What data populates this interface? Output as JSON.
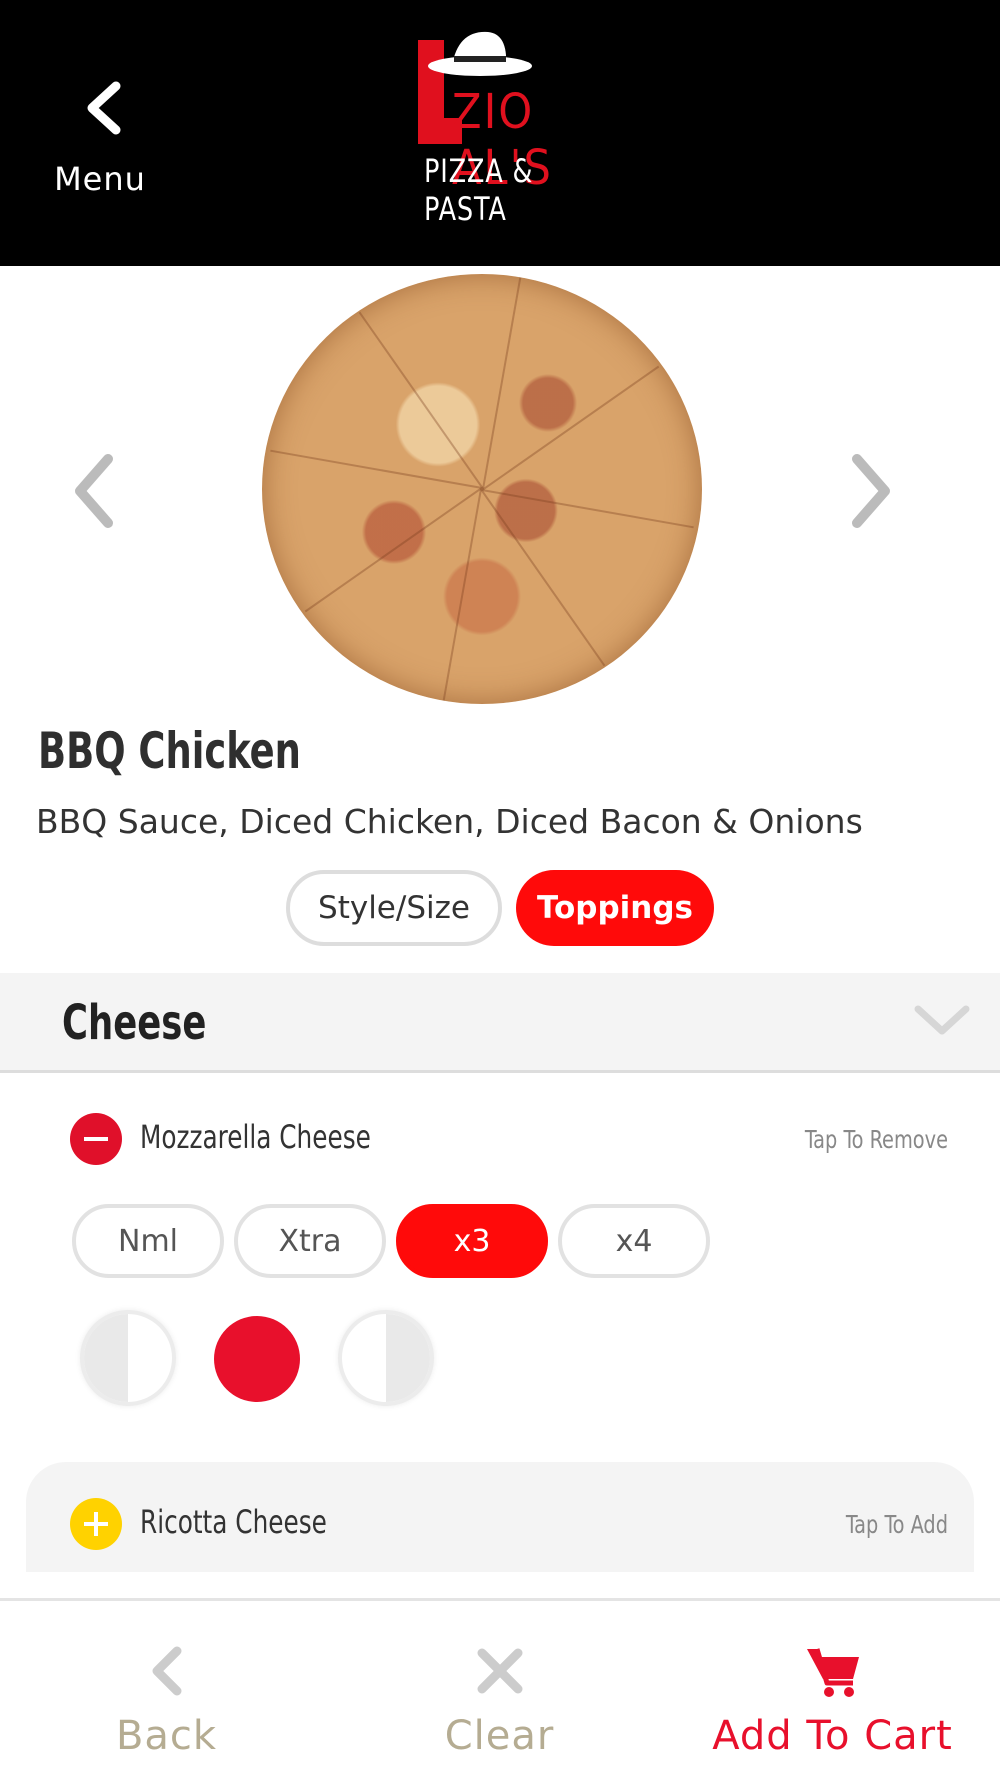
{
  "header": {
    "back_label": "Menu",
    "logo_line1": "ZIO AL'S",
    "logo_line2": "PIZZA & PASTA"
  },
  "product": {
    "name": "BBQ Chicken",
    "description": "BBQ Sauce, Diced Chicken, Diced Bacon & Onions",
    "image_icon": "pizza-image"
  },
  "tabs": [
    {
      "label": "Style/Size",
      "active": false
    },
    {
      "label": "Toppings",
      "active": true
    }
  ],
  "section": {
    "name": "Cheese",
    "icon": "chevron-down-icon"
  },
  "toppings": [
    {
      "name": "Mozzarella Cheese",
      "hint": "Tap To Remove",
      "selected": true,
      "quantities": [
        "Nml",
        "Xtra",
        "x3",
        "x4"
      ],
      "selected_quantity": "x3",
      "coverage": "whole"
    },
    {
      "name": "Ricotta Cheese",
      "hint": "Tap To Add",
      "selected": false
    }
  ],
  "bottom_bar": {
    "back": "Back",
    "clear": "Clear",
    "add_to_cart": "Add To Cart"
  },
  "colors": {
    "accent": "#ff0a0a",
    "remove": "#e0102a",
    "add": "#ffd200",
    "muted_label": "#b5ac92"
  }
}
